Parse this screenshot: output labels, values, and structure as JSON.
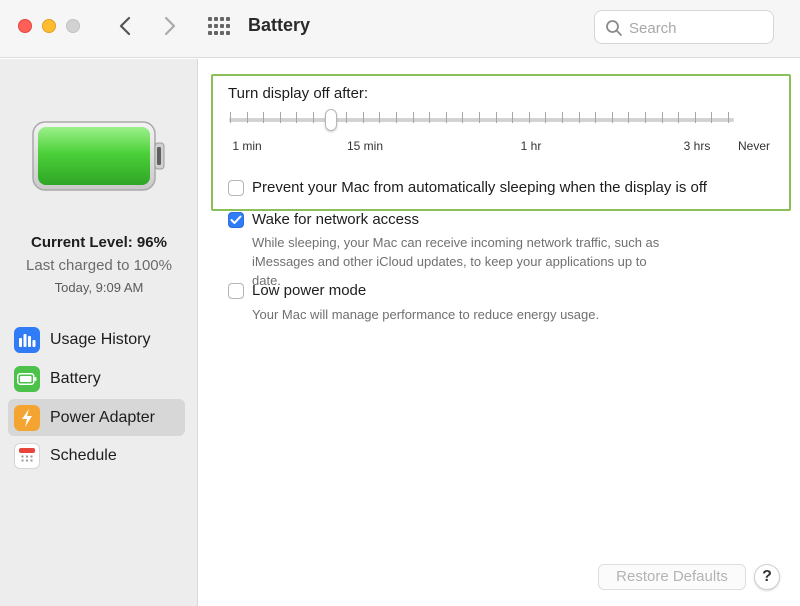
{
  "window": {
    "title": "Battery",
    "traffic_lights": [
      "close",
      "minimize",
      "zoom"
    ]
  },
  "toolbar": {
    "back_icon": "chevron-left-icon",
    "forward_icon": "chevron-right-icon",
    "grid_icon": "show-all-grid-icon",
    "search_placeholder": "Search"
  },
  "sidebar": {
    "battery_status": {
      "current_level": "Current Level: 96%",
      "last_charged": "Last charged to 100%",
      "charged_time": "Today, 9:09 AM",
      "level_fraction": 0.96
    },
    "items": [
      {
        "label": "Usage History",
        "icon": "usage-history-icon",
        "color": "#2f7cf6",
        "selected": false
      },
      {
        "label": "Battery",
        "icon": "battery-icon",
        "color": "#4cc24a",
        "selected": false
      },
      {
        "label": "Power Adapter",
        "icon": "lightning-icon",
        "color": "#f4a531",
        "selected": true
      },
      {
        "label": "Schedule",
        "icon": "calendar-icon",
        "color": "#ffffff",
        "selected": false
      }
    ]
  },
  "main": {
    "slider": {
      "title": "Turn display off after:",
      "labels": [
        "1 min",
        "15 min",
        "1 hr",
        "3 hrs",
        "Never"
      ],
      "value": "15 min"
    },
    "options": [
      {
        "label": "Prevent your Mac from automatically sleeping when the display is off",
        "checked": false,
        "description": ""
      },
      {
        "label": "Wake for network access",
        "checked": true,
        "description": "While sleeping, your Mac can receive incoming network traffic, such as iMessages and other iCloud updates, to keep your applications up to date."
      },
      {
        "label": "Low power mode",
        "checked": false,
        "description": "Your Mac will manage performance to reduce energy usage."
      }
    ]
  },
  "footer": {
    "restore_label": "Restore Defaults",
    "help_label": "?"
  },
  "colors": {
    "accent": "#2f7cf6",
    "battery_green": "#4cd13a",
    "highlight_border": "#8bbf5a"
  }
}
